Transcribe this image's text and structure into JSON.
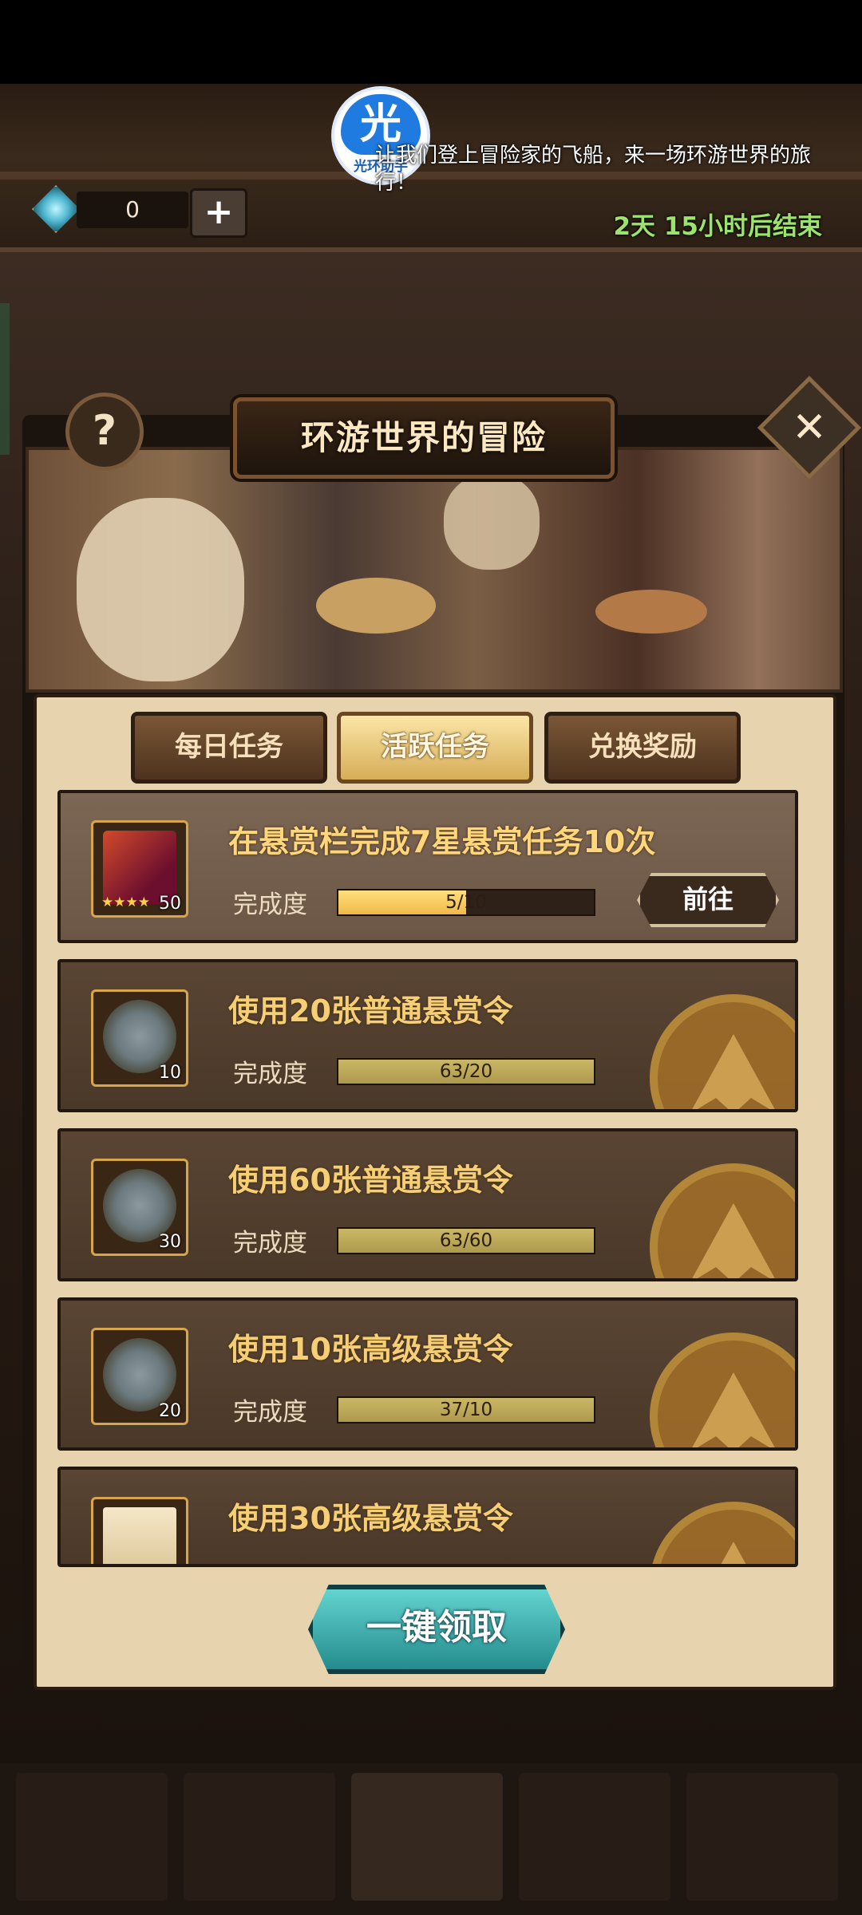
{
  "app_badge": {
    "glyph": "光",
    "label": "光环助手"
  },
  "currency": {
    "amount": "0",
    "add_label": "+"
  },
  "window": {
    "title": "环游世界的冒险",
    "help_label": "?",
    "close_label": "✕",
    "description": "让我们登上冒险家的飞船，来一场环游世界的旅行！",
    "countdown": "2天 15小时后结束"
  },
  "tabs": [
    {
      "label": "每日任务",
      "active": false
    },
    {
      "label": "活跃任务",
      "active": true
    },
    {
      "label": "兑换奖励",
      "active": false
    }
  ],
  "progress_label": "完成度",
  "tasks": [
    {
      "title": "在悬赏栏完成7星悬赏任务10次",
      "reward_count": "50",
      "progress_text": "5/10",
      "progress": 0.5,
      "action_label": "前往"
    },
    {
      "title": "使用20张普通悬赏令",
      "reward_count": "10",
      "progress_text": "63/20",
      "progress": 1.0
    },
    {
      "title": "使用60张普通悬赏令",
      "reward_count": "30",
      "progress_text": "63/60",
      "progress": 1.0
    },
    {
      "title": "使用10张高级悬赏令",
      "reward_count": "20",
      "progress_text": "37/10",
      "progress": 1.0
    },
    {
      "title": "使用30张高级悬赏令"
    }
  ],
  "claim_all_label": "一键领取"
}
